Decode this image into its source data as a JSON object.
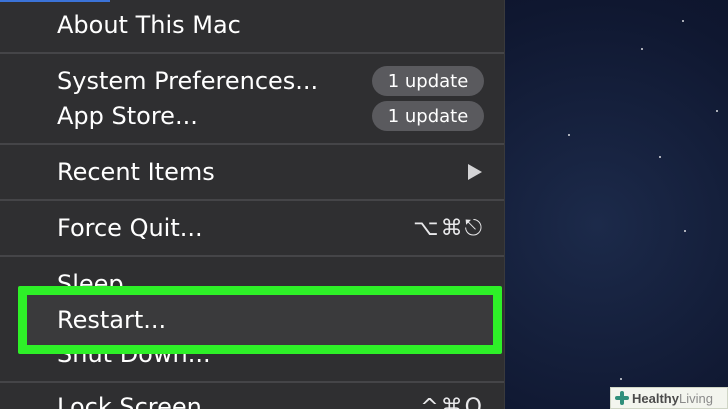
{
  "menu": {
    "items": {
      "about": "About This Mac",
      "system_preferences": "System Preferences...",
      "system_preferences_badge": "1 update",
      "app_store": "App Store...",
      "app_store_badge": "1 update",
      "recent_items": "Recent Items",
      "force_quit": "Force Quit...",
      "force_quit_shortcut": "⌥⌘⎋",
      "sleep": "Sleep",
      "restart": "Restart...",
      "shut_down": "Shut Down...",
      "lock_screen": "Lock Screen",
      "lock_screen_shortcut": "^⌘Q"
    }
  },
  "watermark": {
    "brand_bold": "Healthy",
    "brand_light": "Living"
  },
  "colors": {
    "highlight": "#2ef028",
    "menu_background": "#2f2f31",
    "badge_background": "#5a5a5e"
  }
}
